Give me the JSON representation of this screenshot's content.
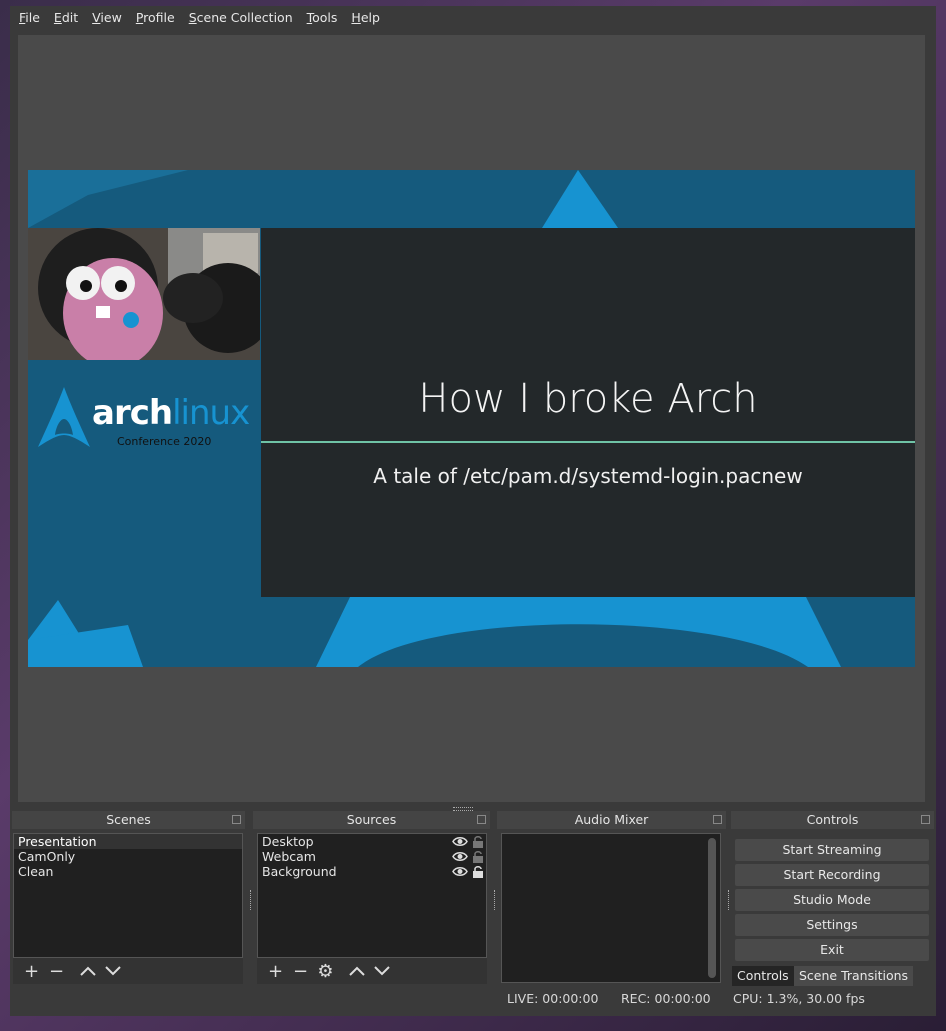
{
  "menu": [
    "File",
    "Edit",
    "View",
    "Profile",
    "Scene Collection",
    "Tools",
    "Help"
  ],
  "menu_mnemonic": [
    "F",
    "E",
    "V",
    "P",
    "S",
    "T",
    "H"
  ],
  "slide": {
    "title": "How I broke Arch",
    "subtitle": "A tale of /etc/pam.d/systemd-login.pacnew",
    "logo_arch": "arch",
    "logo_linux": "linux",
    "logo_sub": "Conference 2020"
  },
  "docks": {
    "scenes": {
      "title": "Scenes",
      "items": [
        "Presentation",
        "CamOnly",
        "Clean"
      ],
      "selected": "Presentation"
    },
    "sources": {
      "title": "Sources",
      "items": [
        "Desktop",
        "Webcam",
        "Background"
      ]
    },
    "mixer": {
      "title": "Audio Mixer"
    },
    "controls": {
      "title": "Controls",
      "buttons": [
        "Start Streaming",
        "Start Recording",
        "Studio Mode",
        "Settings",
        "Exit"
      ],
      "tabs": [
        "Controls",
        "Scene Transitions"
      ]
    }
  },
  "status": {
    "live": "LIVE: 00:00:00",
    "rec": "REC: 00:00:00",
    "cpu": "CPU: 1.3%, 30.00 fps"
  },
  "colors": {
    "arch_blue": "#1793d1",
    "slide_bg": "#23282a",
    "canvas_bg": "#155a7d",
    "rule": "#6fc3a6"
  }
}
